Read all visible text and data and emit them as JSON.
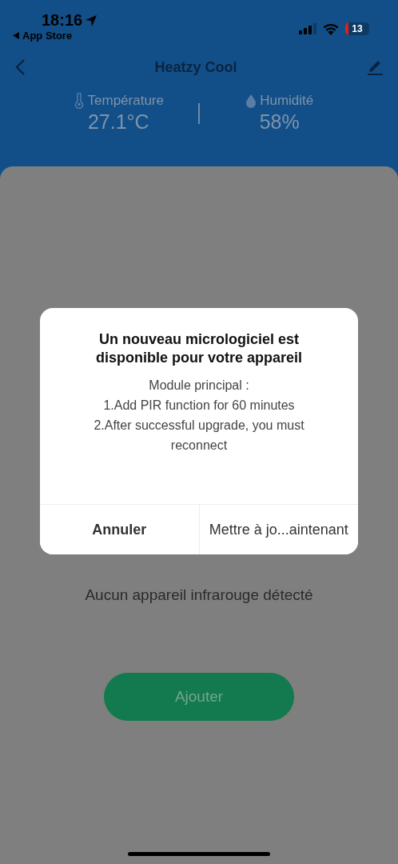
{
  "status_bar": {
    "time": "18:16",
    "back_app": "App Store",
    "battery": "13"
  },
  "nav": {
    "title": "Heatzy Cool"
  },
  "stats": [
    {
      "kind": "temperature",
      "label": "Température",
      "value": "27.1°C"
    },
    {
      "kind": "humidity",
      "label": "Humidité",
      "value": "58%"
    }
  ],
  "content": {
    "empty_message": "Aucun appareil infrarouge détecté",
    "add_button": "Ajouter"
  },
  "dialog": {
    "title": "Un nouveau micrologiciel est disponible pour votre appareil",
    "lines": [
      "Module principal :",
      "1.Add PIR function for 60 minutes",
      "2.After successful upgrade, you must reconnect"
    ],
    "buttons": [
      "Annuler",
      "Mettre à jo...aintenant"
    ]
  }
}
